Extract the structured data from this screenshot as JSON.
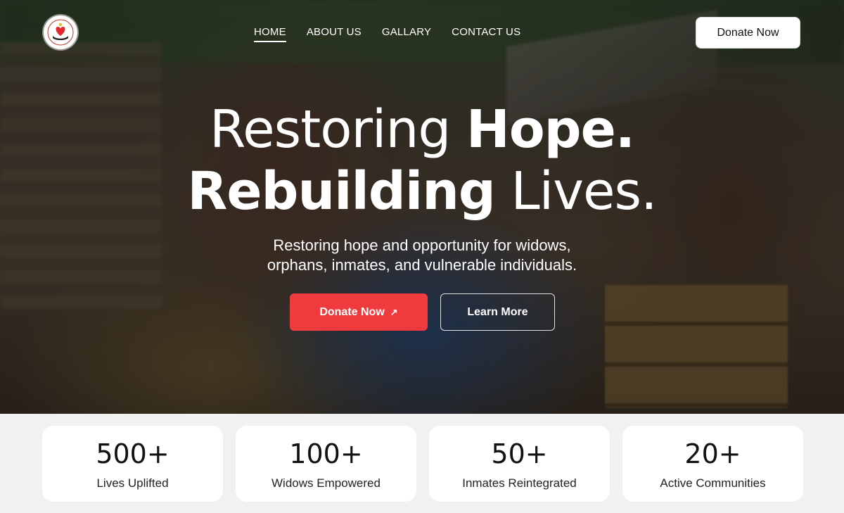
{
  "nav": {
    "items": [
      {
        "label": "HOME",
        "active": true
      },
      {
        "label": "ABOUT US",
        "active": false
      },
      {
        "label": "GALLARY",
        "active": false
      },
      {
        "label": "CONTACT US",
        "active": false
      }
    ],
    "donate_label": "Donate Now",
    "logo_icon": "heart-hands-logo-icon"
  },
  "hero": {
    "headline_line1_light": "Restoring ",
    "headline_line1_bold": "Hope.",
    "headline_line2_bold": "Rebuilding",
    "headline_line2_light": " Lives.",
    "subtext_line1": "Restoring hope and opportunity for widows,",
    "subtext_line2": "orphans, inmates, and vulnerable individuals.",
    "primary_button": "Donate Now",
    "primary_button_icon": "arrow-up-right-icon",
    "secondary_button": "Learn More"
  },
  "stats": [
    {
      "value": "500+",
      "label": "Lives Uplifted"
    },
    {
      "value": "100+",
      "label": "Widows Empowered"
    },
    {
      "value": "50+",
      "label": "Inmates Reintegrated"
    },
    {
      "value": "20+",
      "label": "Active Communities"
    }
  ],
  "colors": {
    "accent": "#ef3b3e",
    "stats_background": "#f1f1f1",
    "card_background": "#ffffff",
    "text_dark": "#111111"
  }
}
